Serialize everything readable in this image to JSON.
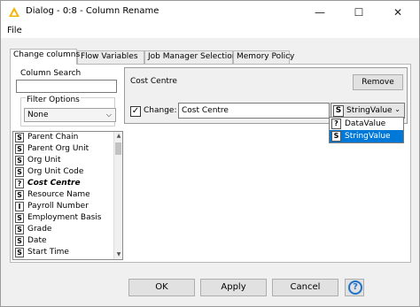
{
  "window": {
    "title": "Dialog - 0:8 - Column Rename",
    "menu": [
      "File"
    ],
    "controls": {
      "minimize": "—",
      "maximize": "☐",
      "close": "✕"
    }
  },
  "tabs": [
    {
      "label": "Change columns",
      "active": true
    },
    {
      "label": "Flow Variables",
      "active": false
    },
    {
      "label": "Job Manager Selection",
      "active": false
    },
    {
      "label": "Memory Policy",
      "active": false
    }
  ],
  "left_panel": {
    "column_search_label": "Column Search",
    "search_value": "",
    "filter_options_label": "Filter Options",
    "filter_selected": "None",
    "columns": [
      {
        "badge": "S",
        "name": "Parent Chain",
        "selected": false
      },
      {
        "badge": "S",
        "name": "Parent Org Unit",
        "selected": false
      },
      {
        "badge": "S",
        "name": "Org Unit",
        "selected": false
      },
      {
        "badge": "S",
        "name": "Org Unit Code",
        "selected": false
      },
      {
        "badge": "?",
        "name": "Cost Centre",
        "selected": true
      },
      {
        "badge": "S",
        "name": "Resource Name",
        "selected": false
      },
      {
        "badge": "I",
        "name": "Payroll Number",
        "selected": false
      },
      {
        "badge": "S",
        "name": "Employment Basis",
        "selected": false
      },
      {
        "badge": "S",
        "name": "Grade",
        "selected": false
      },
      {
        "badge": "S",
        "name": "Date",
        "selected": false
      },
      {
        "badge": "S",
        "name": "Start Time",
        "selected": false
      }
    ]
  },
  "rename_box": {
    "title": "Cost Centre",
    "remove_label": "Remove",
    "change_checked": true,
    "change_label": "Change:",
    "new_name": "Cost Centre",
    "type_badge": "S",
    "type_selected": "StringValue",
    "type_options": [
      {
        "badge": "?",
        "label": "DataValue",
        "selected": false
      },
      {
        "badge": "S",
        "label": "StringValue",
        "selected": true
      }
    ]
  },
  "buttons": {
    "ok": "OK",
    "apply": "Apply",
    "cancel": "Cancel",
    "help": "?"
  },
  "colors": {
    "selection": "#0078d7",
    "help_icon": "#1e73c8",
    "app_icon": "#f5b400"
  }
}
